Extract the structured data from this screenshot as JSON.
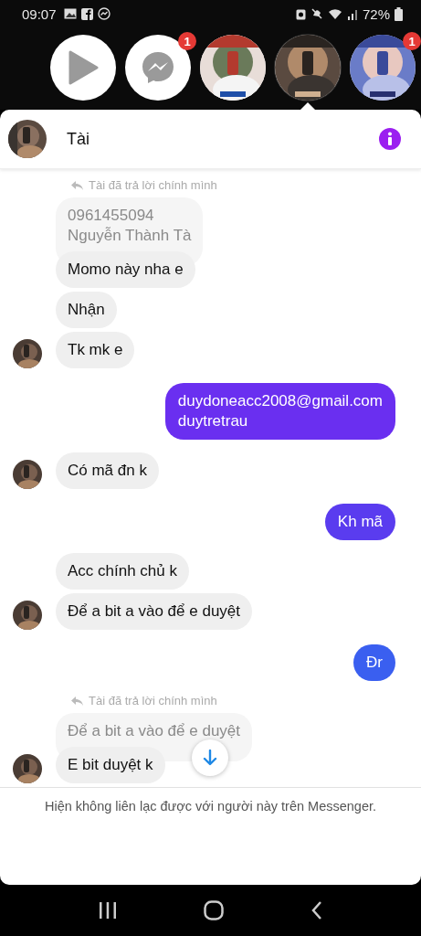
{
  "status_bar": {
    "time": "09:07",
    "battery": "72%"
  },
  "chat_heads": [
    {
      "kind": "play",
      "selected": false
    },
    {
      "kind": "messenger",
      "selected": false,
      "badge": "1"
    },
    {
      "kind": "picture",
      "selected": false
    },
    {
      "kind": "picture",
      "selected": true
    },
    {
      "kind": "picture",
      "selected": false,
      "badge": "1"
    }
  ],
  "conversation": {
    "name": "Tài"
  },
  "messages": [
    {
      "kind": "reply_note",
      "text": "Tài đã trả lời chính mình"
    },
    {
      "kind": "quoted",
      "lines": [
        "0961455094",
        "Nguyễn Thành Tà"
      ]
    },
    {
      "kind": "received",
      "lines": [
        "Momo này nha e"
      ],
      "avatar": false
    },
    {
      "kind": "received",
      "lines": [
        "Nhận"
      ],
      "avatar": false
    },
    {
      "kind": "received",
      "lines": [
        "Tk mk e"
      ],
      "avatar": true
    },
    {
      "kind": "sent",
      "lines": [
        "duydoneacc2008@gmail.com",
        "duytretrau"
      ],
      "color": "#6a2ff0"
    },
    {
      "kind": "received",
      "lines": [
        "Có mã đn k"
      ],
      "avatar": true
    },
    {
      "kind": "sent",
      "lines": [
        "Kh mã"
      ],
      "color": "#5a3cef"
    },
    {
      "kind": "received",
      "lines": [
        "Acc chính chủ k"
      ],
      "avatar": false
    },
    {
      "kind": "received",
      "lines": [
        "Để a bit a vào để e duyệt"
      ],
      "avatar": true
    },
    {
      "kind": "sent",
      "lines": [
        "Đr"
      ],
      "color": "#3a5ff0"
    },
    {
      "kind": "reply_note",
      "text": "Tài đã trả lời chính mình"
    },
    {
      "kind": "quoted",
      "lines": [
        "Để a bit a vào để e duyệt"
      ]
    },
    {
      "kind": "received",
      "lines": [
        "E bit duyệt k"
      ],
      "avatar": true
    }
  ],
  "footer": {
    "notice": "Hiện không liên lạc được với người này trên Messenger."
  }
}
